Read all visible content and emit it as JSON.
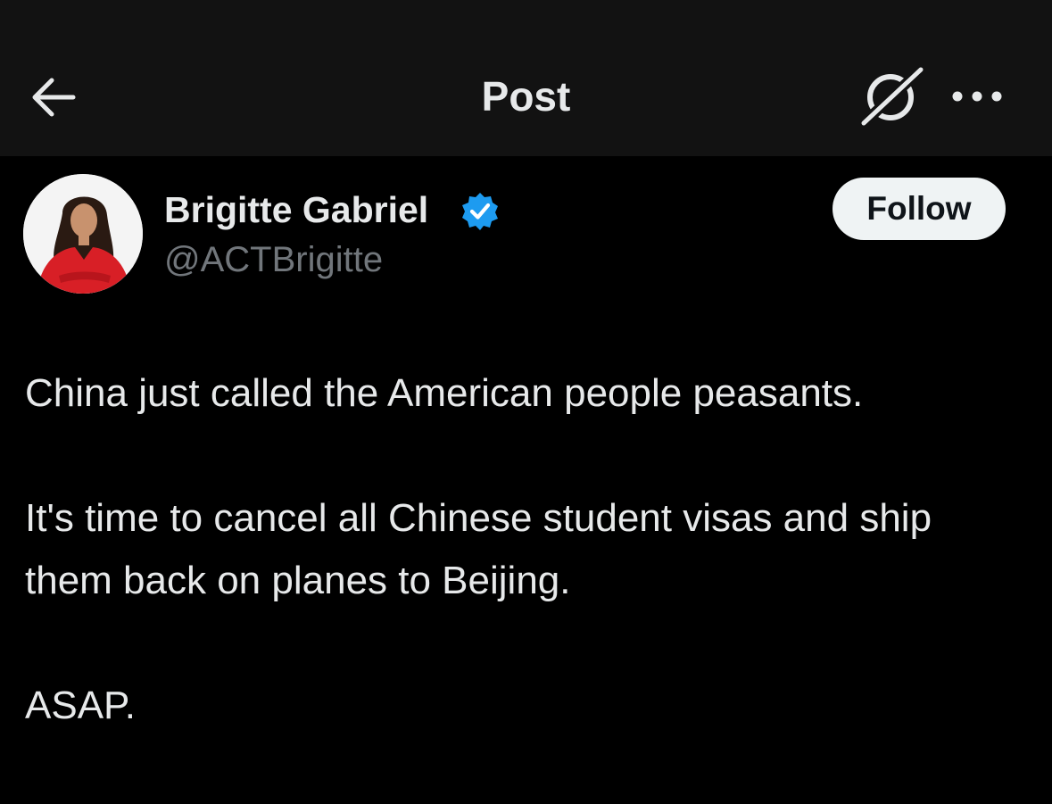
{
  "header": {
    "title": "Post",
    "back_icon": "arrow-left-icon",
    "grok_icon": "grok-icon",
    "more_icon": "more-dots-icon"
  },
  "author": {
    "name": "Brigitte Gabriel",
    "handle": "@ACTBrigitte",
    "verified": true,
    "verified_color": "#1d9bf0"
  },
  "actions": {
    "follow_label": "Follow"
  },
  "post": {
    "paragraphs": [
      "China just called the American people peasants.",
      "It's time to cancel all Chinese student visas and ship them back on planes to Beijing.",
      "ASAP."
    ]
  },
  "colors": {
    "background": "#000000",
    "header_background": "#121212",
    "text_primary": "#e7e9ea",
    "text_secondary": "#71767b",
    "follow_background": "#eff3f4"
  }
}
